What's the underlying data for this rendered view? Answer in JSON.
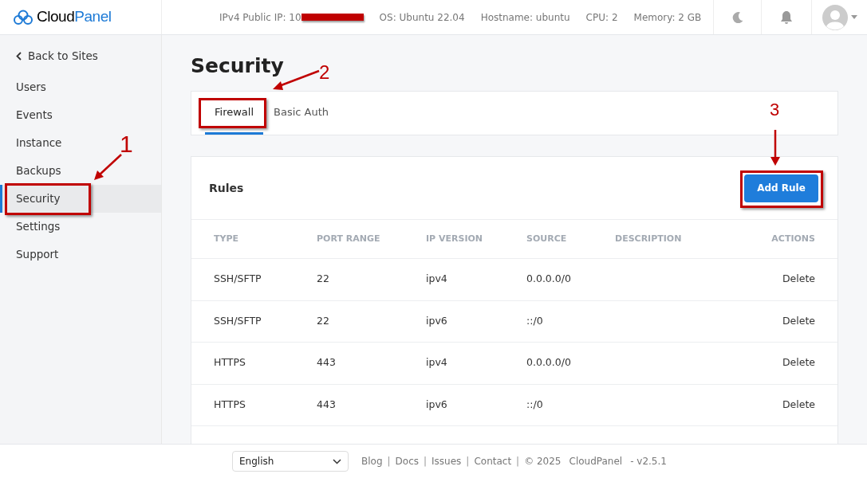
{
  "header": {
    "logo": {
      "part1": "Cloud",
      "part2": "Panel"
    },
    "info": [
      {
        "label": "IPv4 Public IP:",
        "value": "10",
        "redacted": true
      },
      {
        "label": "OS:",
        "value": "Ubuntu 22.04",
        "redacted": false
      },
      {
        "label": "Hostname:",
        "value": "ubuntu",
        "redacted": false
      },
      {
        "label": "CPU:",
        "value": "2",
        "redacted": false
      },
      {
        "label": "Memory:",
        "value": "2 GB",
        "redacted": false
      }
    ]
  },
  "sidebar": {
    "back": "Back to Sites",
    "items": [
      {
        "label": "Users",
        "selected": false
      },
      {
        "label": "Events",
        "selected": false
      },
      {
        "label": "Instance",
        "selected": false
      },
      {
        "label": "Backups",
        "selected": false
      },
      {
        "label": "Security",
        "selected": true,
        "annotation": "1"
      },
      {
        "label": "Settings",
        "selected": false
      },
      {
        "label": "Support",
        "selected": false
      }
    ]
  },
  "page_title": "Security",
  "tabs": [
    {
      "label": "Firewall",
      "selected": true,
      "annotation": "2"
    },
    {
      "label": "Basic Auth",
      "selected": false
    }
  ],
  "rules": {
    "title": "Rules",
    "add_button": "Add Rule",
    "add_button_annotation": "3",
    "columns": [
      "TYPE",
      "PORT RANGE",
      "IP VERSION",
      "SOURCE",
      "DESCRIPTION",
      "ACTIONS"
    ],
    "rows": [
      {
        "type": "SSH/SFTP",
        "port": "22",
        "ip_version": "ipv4",
        "source": "0.0.0.0/0",
        "action": "Delete"
      },
      {
        "type": "SSH/SFTP",
        "port": "22",
        "ip_version": "ipv6",
        "source": "::/0",
        "action": "Delete"
      },
      {
        "type": "HTTPS",
        "port": "443",
        "ip_version": "ipv4",
        "source": "0.0.0.0/0",
        "action": "Delete"
      },
      {
        "type": "HTTPS",
        "port": "443",
        "ip_version": "ipv6",
        "source": "::/0",
        "action": "Delete"
      }
    ]
  },
  "footer": {
    "language": "English",
    "links": [
      {
        "label": "Blog",
        "separator": "|"
      },
      {
        "label": "Docs",
        "separator": "|"
      },
      {
        "label": "Issues",
        "separator": "|"
      },
      {
        "label": "Contact",
        "separator": "|"
      }
    ],
    "copyright": "© 2025",
    "brand": "CloudPanel",
    "version": "- v2.5.1"
  }
}
